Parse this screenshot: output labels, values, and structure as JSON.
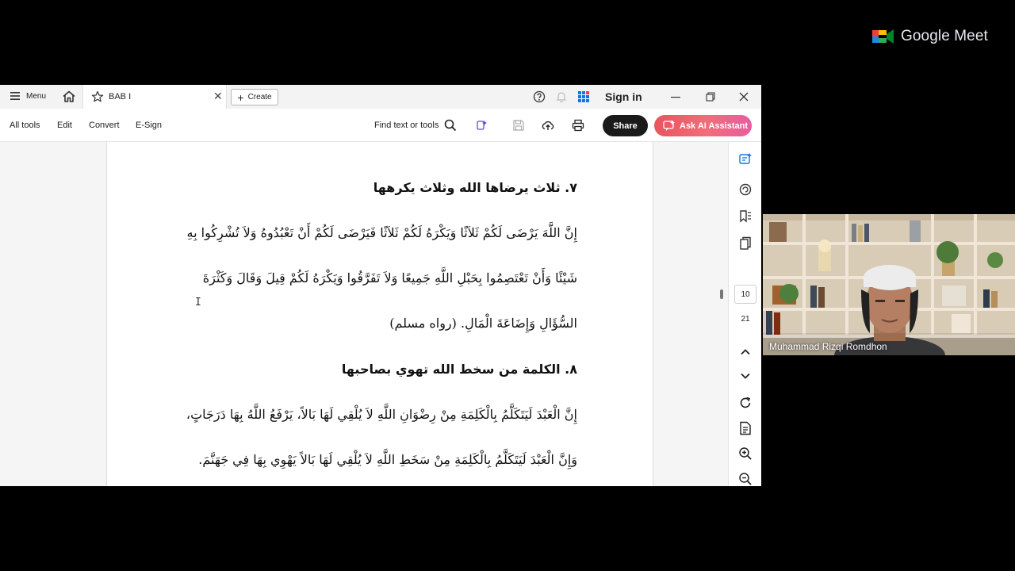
{
  "meet": {
    "brand": "Google Meet"
  },
  "titlebar": {
    "menu_label": "Menu",
    "tab_title": "BAB I",
    "create_label": "Create",
    "signin_label": "Sign in"
  },
  "toolbar": {
    "all_tools": "All tools",
    "edit": "Edit",
    "convert": "Convert",
    "esign": "E-Sign",
    "find_label": "Find text or tools",
    "share_label": "Share",
    "ai_label": "Ask AI Assistant"
  },
  "document": {
    "heading7": "٧.  ثلاث يرضاها الله وثلاث يكرهها",
    "p1_line1": "إِنَّ اللَّهَ يَرْضَى لَكُمْ ثَلاَثًا وَيَكْرَهُ لَكُمْ ثَلاَثًا فَيَرْضَى لَكُمْ أَنْ تَعْبُدُوهُ وَلاَ تُشْرِكُوا بِهِ",
    "p1_line2": "شَيْئًا وَأَنْ تَعْتَصِمُوا بِحَبْلِ اللَّهِ جَمِيعًا وَلاَ تَفَرَّقُوا وَيَكْرَهُ لَكُمْ قِيلَ وَقَالَ وَكَثْرَةَ",
    "p1_line3": "السُّؤَالِ وَإِضَاعَةَ الْمَالِ. (رواه مسلم)",
    "heading8": "٨.  الكلمة من سخط الله تهوي بصاحبها",
    "p2_line1": "إِنَّ الْعَبْدَ لَيَتَكَلَّمُ بِالْكَلِمَةِ مِنْ رِضْوَانِ اللَّهِ لاَ يُلْقِي لَهَا بَالاً، يَرْفَعُ اللَّهُ بِهَا دَرَجَاتٍ،",
    "p2_line2": "وَإِنَّ الْعَبْدَ لَيَتَكَلَّمُ بِالْكَلِمَةِ مِنْ سَخَطِ اللَّهِ لاَ يُلْقِي لَهَا بَالاً يَهْوِي بِهَا فِي جَهَنَّمَ."
  },
  "pager": {
    "current": "10",
    "total": "21"
  },
  "video": {
    "participant": "Muhammad Rizqi Romdhon"
  },
  "colors": {
    "ai_button": "#ec5d6a",
    "share_button": "#1a1a1a",
    "meet_bg": "#000000"
  }
}
